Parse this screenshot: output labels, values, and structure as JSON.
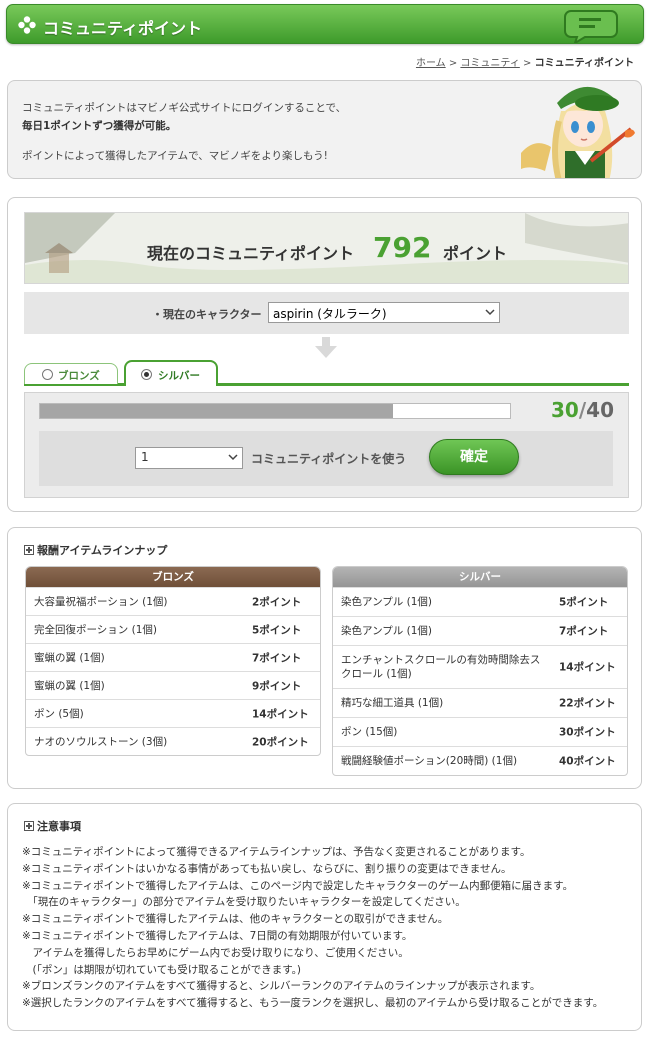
{
  "header": {
    "title": "コミュニティポイント"
  },
  "breadcrumb": {
    "home": "ホーム",
    "sep": ">",
    "community": "コミュニティ",
    "current": "コミュニティポイント"
  },
  "intro": {
    "line1": "コミュニティポイントはマビノギ公式サイトにログインすることで、",
    "line2": "毎日1ポイントずつ獲得が可能。",
    "line3": "ポイントによって獲得したアイテムで、マビノギをより楽しもう!"
  },
  "points": {
    "label": "現在のコミュニティポイント",
    "value": "792",
    "unit": "ポイント"
  },
  "character": {
    "label": "・現在のキャラクター",
    "selected": "aspirin (タルラーク)"
  },
  "tabs": [
    {
      "label": "ブロンズ",
      "selected": false
    },
    {
      "label": "シルバー",
      "selected": true
    }
  ],
  "progress": {
    "current": "30",
    "separator": "/",
    "max": "40",
    "fraction": 0.75
  },
  "use": {
    "quantity": "1",
    "label": "コミュニティポイントを使う",
    "confirm": "確定"
  },
  "rewards": {
    "title": "報酬アイテムラインナップ",
    "bronze": {
      "header": "ブロンズ",
      "items": [
        {
          "name": "大容量祝福ポーション (1個)",
          "points": "2ポイント"
        },
        {
          "name": "完全回復ポーション (1個)",
          "points": "5ポイント"
        },
        {
          "name": "蜜蝋の翼 (1個)",
          "points": "7ポイント"
        },
        {
          "name": "蜜蝋の翼 (1個)",
          "points": "9ポイント"
        },
        {
          "name": "ポン (5個)",
          "points": "14ポイント"
        },
        {
          "name": "ナオのソウルストーン (3個)",
          "points": "20ポイント"
        }
      ]
    },
    "silver": {
      "header": "シルバー",
      "items": [
        {
          "name": "染色アンプル (1個)",
          "points": "5ポイント"
        },
        {
          "name": "染色アンプル (1個)",
          "points": "7ポイント"
        },
        {
          "name": "エンチャントスクロールの有効時間除去スクロール (1個)",
          "points": "14ポイント"
        },
        {
          "name": "精巧な細工道具 (1個)",
          "points": "22ポイント"
        },
        {
          "name": "ポン (15個)",
          "points": "30ポイント"
        },
        {
          "name": "戦闘経験値ポーション(20時間) (1個)",
          "points": "40ポイント"
        }
      ]
    }
  },
  "notes": {
    "title": "注意事項",
    "lines": [
      "※コミュニティポイントによって獲得できるアイテムラインナップは、予告なく変更されることがあります。",
      "※コミュニティポイントはいかなる事情があっても払い戻し、ならびに、割り振りの変更はできません。",
      "※コミュニティポイントで獲得したアイテムは、このページ内で設定したキャラクターのゲーム内郵便箱に届きます。",
      "　「現在のキャラクター」の部分でアイテムを受け取りたいキャラクターを設定してください。",
      "※コミュニティポイントで獲得したアイテムは、他のキャラクターとの取引ができません。",
      "※コミュニティポイントで獲得したアイテムは、7日間の有効期限が付いています。",
      "　アイテムを獲得したらお早めにゲーム内でお受け取りになり、ご使用ください。",
      "　(「ポン」は期限が切れていても受け取ることができます。)",
      "※ブロンズランクのアイテムをすべて獲得すると、シルバーランクのアイテムのラインナップが表示されます。",
      "※選択したランクのアイテムをすべて獲得すると、もう一度ランクを選択し、最初のアイテムから受け取ることができます。"
    ]
  }
}
